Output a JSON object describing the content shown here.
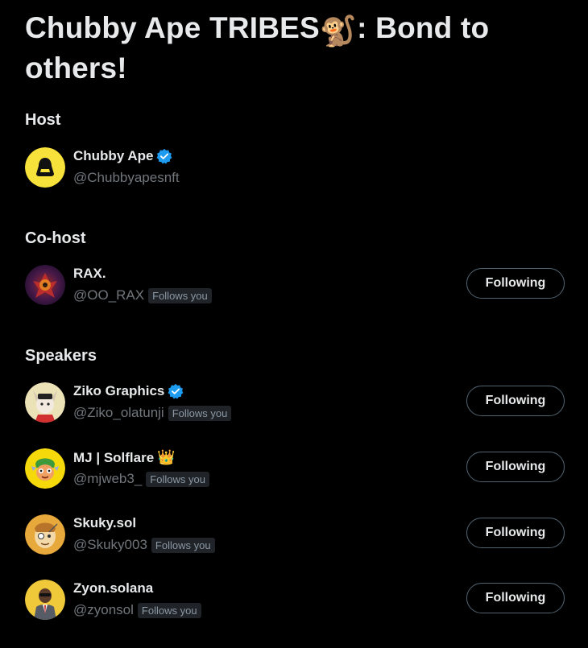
{
  "space": {
    "title_part1": "Chubby Ape TRIBES",
    "title_emoji": "🐒",
    "title_part2": ": Bond to others!"
  },
  "sections": {
    "host": "Host",
    "cohost": "Co-host",
    "speakers": "Speakers"
  },
  "host": {
    "name": "Chubby Ape",
    "handle": "@Chubbyapesnft",
    "verified": true,
    "avatar_color": "#f7e13b"
  },
  "cohost": {
    "name": "RAX.",
    "handle": "@OO_RAX",
    "follows_you": "Follows you",
    "button": "Following"
  },
  "speakers": [
    {
      "name": "Ziko Graphics",
      "handle": "@Ziko_olatunji",
      "follows_you": "Follows you",
      "button": "Following",
      "verified": true
    },
    {
      "name": "MJ | Solflare",
      "suffix": "👑",
      "handle": "@mjweb3_",
      "follows_you": "Follows you",
      "button": "Following"
    },
    {
      "name": "Skuky.sol",
      "handle": "@Skuky003",
      "follows_you": "Follows you",
      "button": "Following"
    },
    {
      "name": "Zyon.solana",
      "handle": "@zyonsol",
      "follows_you": "Follows you",
      "button": "Following"
    }
  ],
  "colors": {
    "background": "#000000",
    "text_primary": "#e7e9ea",
    "text_secondary": "#71767b",
    "verified_blue": "#1d9bf0",
    "button_border": "#536471"
  }
}
